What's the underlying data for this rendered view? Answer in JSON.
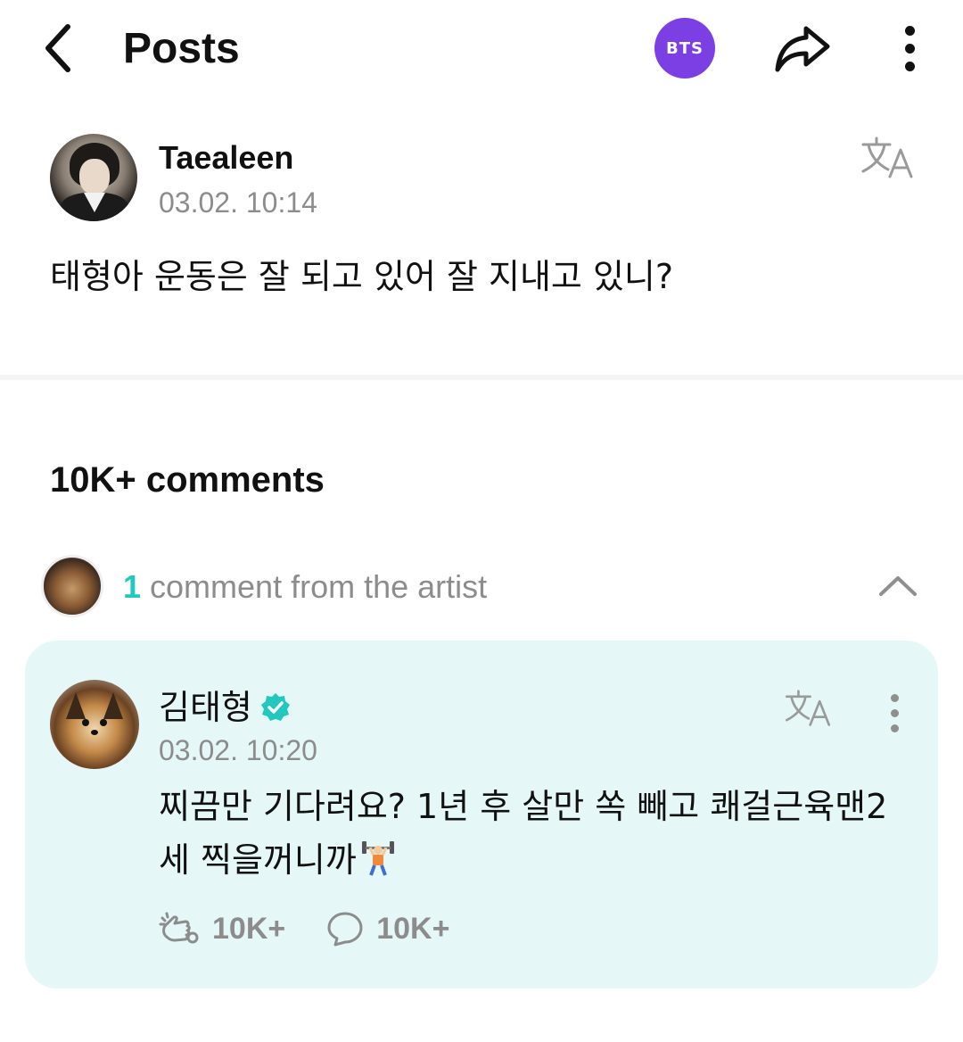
{
  "header": {
    "title": "Posts",
    "community_badge": "BTS",
    "badge_color": "#7b3fe4"
  },
  "icons": {
    "back": "chevron-left-icon",
    "share": "share-arrow-icon",
    "more": "more-vertical-icon",
    "translate": "translate-icon",
    "collapse": "chevron-up-icon",
    "verified": "verified-badge-icon",
    "cheer": "cheer-icon",
    "comment": "comment-bubble-icon"
  },
  "post": {
    "author": "Taealeen",
    "date": "03.02. 10:14",
    "text": "태형아 운동은 잘 되고 있어 잘 지내고 있니?"
  },
  "comments": {
    "count_label": "10K+ comments",
    "artist_count": "1",
    "artist_label": "comment from the artist"
  },
  "artist_comment": {
    "author": "김태형",
    "date": "03.02. 10:20",
    "text": "찌끔만 기다려요? 1년 후 살만 쏙 빼고 쾌걸근육맨2세 찍을꺼니까",
    "likes": "10K+",
    "replies": "10K+",
    "accent_color": "#22c7bd",
    "card_color": "#e5f8f7"
  }
}
